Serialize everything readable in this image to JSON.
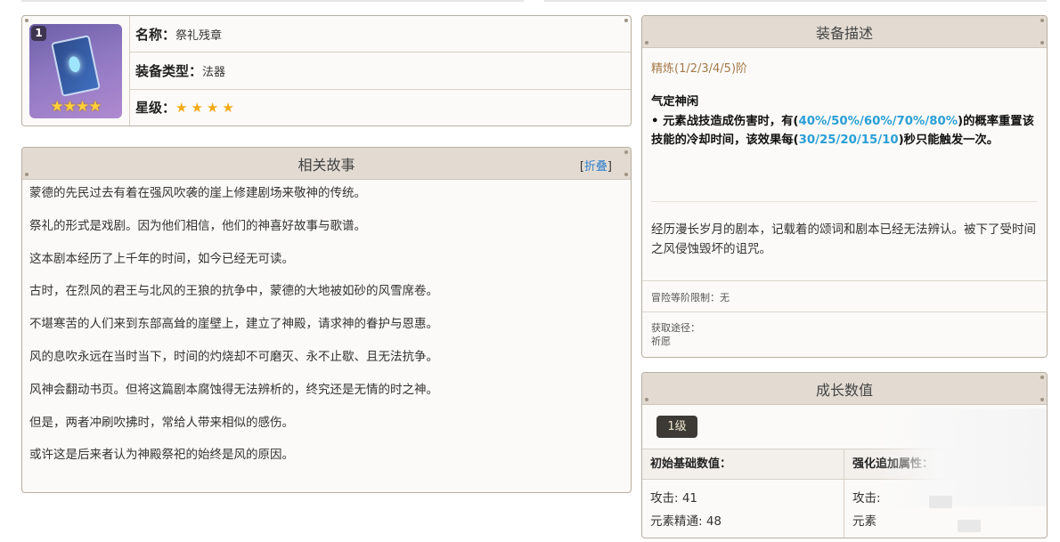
{
  "item": {
    "rank_badge": "1",
    "name_label": "名称：",
    "name_value": "祭礼残章",
    "type_label": "装备类型：",
    "type_value": "法器",
    "star_label": "星级：",
    "stars": "★★★★",
    "thumb_stars": "★★★★"
  },
  "story": {
    "title": "相关故事",
    "fold_open": "[",
    "fold_link": "折叠",
    "fold_close": "]",
    "paragraphs": [
      "蒙德的先民过去有着在强风吹袭的崖上修建剧场来敬神的传统。",
      "祭礼的形式是戏剧。因为他们相信，他们的神喜好故事与歌谱。",
      "这本剧本经历了上千年的时间，如今已经无可读。",
      "古时，在烈风的君王与北风的王狼的抗争中，蒙德的大地被如砂的风雪席卷。",
      "不堪寒苦的人们来到东部高耸的崖壁上，建立了神殿，请求神的眷护与恩惠。",
      "风的息吹永远在当时当下，时间的灼烧却不可磨灭、永不止歇、且无法抗争。",
      "风神会翻动书页。但将这篇剧本腐蚀得无法辨析的，终究还是无情的时之神。",
      "但是，两者冲刷吹拂时，常给人带来相似的感伤。",
      "或许这是后来者认为神殿祭祀的始终是风的原因。"
    ]
  },
  "equip": {
    "title": "装备描述",
    "refine": "精炼(1/2/3/4/5)阶",
    "effect_name": "气定神闲",
    "effect_pre": "• 元素战技造成伤害时，有(",
    "effect_chance": "40%/50%/60%/70%/80%",
    "effect_mid": ")的概率重置该技能的冷却时间，该效果每(",
    "effect_cd": "30/25/20/15/10",
    "effect_post": ")秒只能触发一次。",
    "lore": "经历漫长岁月的剧本，记载着的颂词和剧本已经无法辨认。被下了受时间之风侵蚀毁坏的诅咒。",
    "limit": "冒险等阶限制：无",
    "source_label": "获取途径：",
    "source_value": "祈愿"
  },
  "growth": {
    "title": "成长数值",
    "level": "1级",
    "base_header": "初始基础数值：",
    "bonus_header": "强化追加属性：",
    "base_values": [
      "攻击: 41",
      "元素精通: 48"
    ],
    "bonus_prefix_1": "攻击:",
    "bonus_prefix_2": "元素"
  },
  "colors": {
    "header_bg": "#e3dbd2",
    "border": "#b8aea2",
    "highlight_blue": "#2a9fd6",
    "refine_text": "#a57a4a",
    "star": "#f3a916"
  }
}
